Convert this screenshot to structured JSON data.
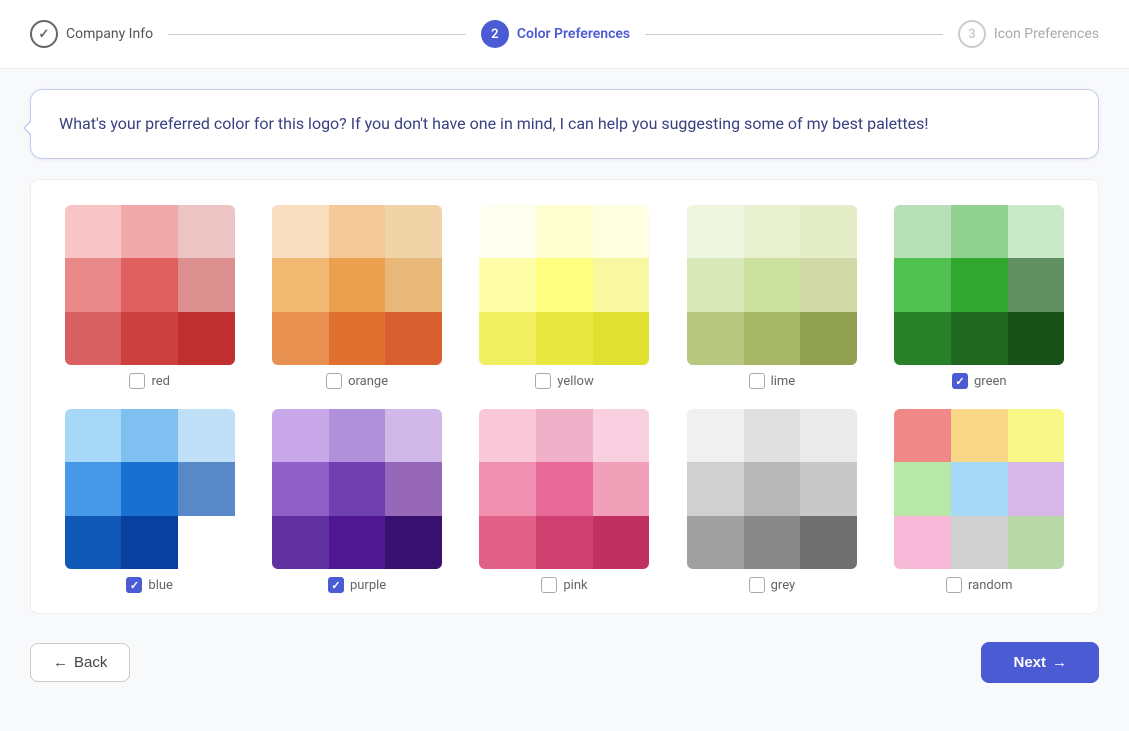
{
  "header": {
    "steps": [
      {
        "id": "company-info",
        "number": "✓",
        "label": "Company Info",
        "state": "completed"
      },
      {
        "id": "color-preferences",
        "number": "2",
        "label": "Color Preferences",
        "state": "active"
      },
      {
        "id": "icon-preferences",
        "number": "3",
        "label": "Icon Preferences",
        "state": "inactive"
      }
    ]
  },
  "chat": {
    "message": "What's your preferred color for this logo? If you don't have one in mind, I can help you suggesting some of my best palettes!"
  },
  "palettes": [
    {
      "id": "red",
      "label": "red",
      "checked": false,
      "colors": [
        "#f7c5c5",
        "#f0a8a8",
        "#edc4c4",
        "#e88888",
        "#e06060",
        "#dc9090",
        "#d86060",
        "#cc4040",
        "#c03030"
      ]
    },
    {
      "id": "orange",
      "label": "orange",
      "checked": false,
      "colors": [
        "#f9dfc0",
        "#f5c898",
        "#f0d4a8",
        "#f0b870",
        "#eba050",
        "#e8b878",
        "#e89050",
        "#e07030",
        "#d86030"
      ]
    },
    {
      "id": "yellow",
      "label": "yellow",
      "checked": false,
      "colors": [
        "#fffff0",
        "#fefed0",
        "#fefee0",
        "#fefea8",
        "#fefe80",
        "#f8f8a0",
        "#f0f060",
        "#e8e840",
        "#e0e030"
      ]
    },
    {
      "id": "lime",
      "label": "lime",
      "checked": false,
      "colors": [
        "#f0f5e0",
        "#e8f0d0",
        "#e4edc8",
        "#d8e8b8",
        "#cce0a0",
        "#d0d8a8",
        "#b8c880",
        "#a8b868",
        "#90a050"
      ]
    },
    {
      "id": "green",
      "label": "green",
      "checked": true,
      "colors": [
        "#b8e0b8",
        "#90d090",
        "#c8e8c8",
        "#50c050",
        "#30a830",
        "#609060",
        "#288028",
        "#206820",
        "#185018"
      ]
    },
    {
      "id": "blue",
      "label": "blue",
      "checked": true,
      "colors": [
        "#a8d8f8",
        "#80c0f0",
        "#c0e0f8",
        "#4898e8",
        "#1870d0",
        "#5888c8",
        "#1058b8",
        "#0840a0",
        "#0030880"
      ]
    },
    {
      "id": "purple",
      "label": "purple",
      "checked": true,
      "colors": [
        "#c8a8e8",
        "#b090d8",
        "#d0b8e8",
        "#9060c8",
        "#7040b0",
        "#9868b8",
        "#6030a0",
        "#501890",
        "#381070"
      ]
    },
    {
      "id": "pink",
      "label": "pink",
      "checked": false,
      "colors": [
        "#f8c8d8",
        "#f0b0c8",
        "#f8d0e0",
        "#f090b0",
        "#e86898",
        "#f0a0b8",
        "#e06088",
        "#d04070",
        "#c03060"
      ]
    },
    {
      "id": "grey",
      "label": "grey",
      "checked": false,
      "colors": [
        "#f0f0f0",
        "#e0e0e0",
        "#ebebeb",
        "#d0d0d0",
        "#b8b8b8",
        "#c8c8c8",
        "#a0a0a0",
        "#888888",
        "#707070"
      ]
    },
    {
      "id": "random",
      "label": "random",
      "checked": false,
      "colors": [
        "#f08888",
        "#f8d888",
        "#f8f888",
        "#b8e8a8",
        "#a8d8f8",
        "#d8b8e8",
        "#f8b8d8",
        "#d0d0d0",
        "#b8d8a8"
      ]
    }
  ],
  "footer": {
    "back_label": "Back",
    "next_label": "Next",
    "back_arrow": "←",
    "next_arrow": "→"
  }
}
